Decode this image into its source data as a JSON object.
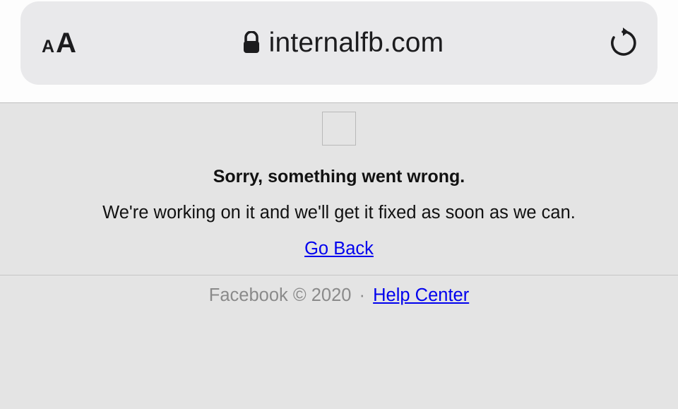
{
  "chrome": {
    "domain": "internalfb.com"
  },
  "page": {
    "heading": "Sorry, something went wrong.",
    "subheading": "We're working on it and we'll get it fixed as soon as we can.",
    "go_back": "Go Back"
  },
  "footer": {
    "copyright": "Facebook © 2020",
    "dot": "·",
    "help_center": "Help Center"
  }
}
